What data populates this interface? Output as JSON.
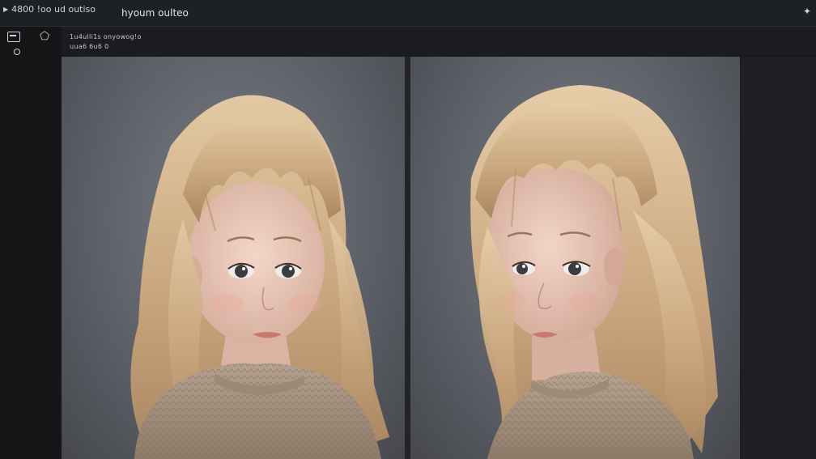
{
  "titlebar": {
    "menu": "4800  !oo  ud  outiso",
    "title": "hyoum oulteo",
    "right_icon": "puzzle-icon"
  },
  "sidebar": {
    "icons": [
      "panel-icon",
      "tag-icon",
      "circle-icon"
    ]
  },
  "info": {
    "line1": "1u4ulli1s onyowog!o",
    "line2": "uua6 6u6 0"
  },
  "panels": [
    {
      "name": "left-portrait",
      "subject": "portrait-front"
    },
    {
      "name": "right-portrait",
      "subject": "portrait-three-quarter"
    }
  ],
  "colors": {
    "hair": "#c9a77f",
    "hair_highlight": "#e7cfab",
    "skin": "#e9c7b8",
    "sweater": "#a69281",
    "background_gray": "#62656c"
  }
}
